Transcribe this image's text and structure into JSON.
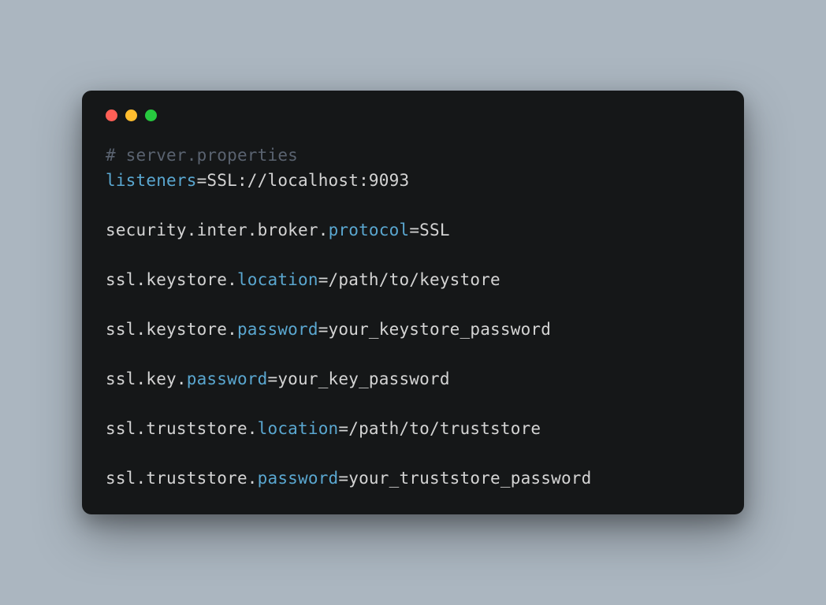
{
  "colors": {
    "bg": "#abb6c0",
    "window": "#151718",
    "comment": "#5a6370",
    "keyword": "#5aa7d0",
    "text": "#d4d4d4",
    "close": "#ff5f56",
    "minimize": "#ffbd2e",
    "maximize": "#27c93f"
  },
  "code": {
    "comment": "# server.properties",
    "l1_key": "listeners",
    "l1_eq": "=SSL://localhost:9093",
    "l2_pre": "security.inter.broker.",
    "l2_key": "protocol",
    "l2_eq": "=SSL",
    "l3_pre": "ssl.keystore.",
    "l3_key": "location",
    "l3_eq": "=/path/to/keystore",
    "l4_pre": "ssl.keystore.",
    "l4_key": "password",
    "l4_eq": "=your_keystore_password",
    "l5_pre": "ssl.key.",
    "l5_key": "password",
    "l5_eq": "=your_key_password",
    "l6_pre": "ssl.truststore.",
    "l6_key": "location",
    "l6_eq": "=/path/to/truststore",
    "l7_pre": "ssl.truststore.",
    "l7_key": "password",
    "l7_eq": "=your_truststore_password"
  }
}
